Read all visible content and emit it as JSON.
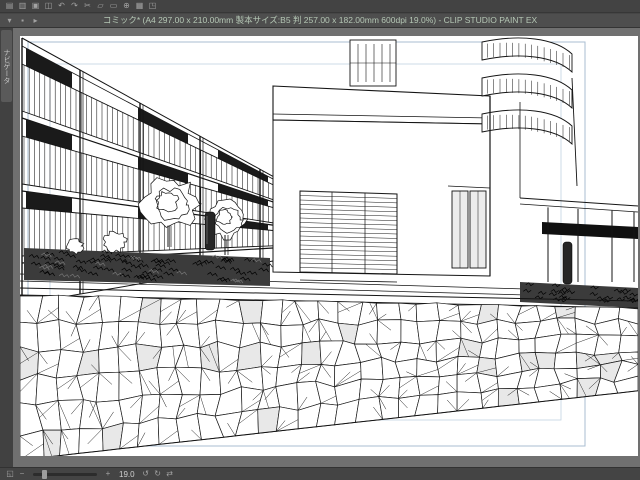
{
  "window": {
    "title": "コミック* (A4 297.00 x 210.00mm 製本サイズ:B5 判 257.00 x 182.00mm 600dpi 19.0%) - CLIP STUDIO PAINT EX"
  },
  "command_bar": {
    "row1_icons": [
      {
        "name": "new-file-icon",
        "glyph": "▤"
      },
      {
        "name": "open-file-icon",
        "glyph": "▥"
      },
      {
        "name": "save-icon",
        "glyph": "▣"
      },
      {
        "name": "save-all-icon",
        "glyph": "◫"
      },
      {
        "name": "undo-icon",
        "glyph": "↶"
      },
      {
        "name": "redo-icon",
        "glyph": "↷"
      },
      {
        "name": "cut-icon",
        "glyph": "✂"
      },
      {
        "name": "copy-icon",
        "glyph": "▱"
      },
      {
        "name": "paste-icon",
        "glyph": "▭"
      },
      {
        "name": "zoom-icon",
        "glyph": "⊕"
      },
      {
        "name": "grid-icon",
        "glyph": "▦"
      },
      {
        "name": "rotate-canvas-icon",
        "glyph": "◳"
      }
    ],
    "row2_icons": [
      {
        "name": "dropdown-icon",
        "glyph": "▾"
      },
      {
        "name": "tool-switch-icon",
        "glyph": "▪"
      },
      {
        "name": "expand-icon",
        "glyph": "▸"
      }
    ]
  },
  "sidebar": {
    "tab_label": "ナビゲータ"
  },
  "statusbar": {
    "left_icons": [
      {
        "name": "fit-to-screen-icon",
        "glyph": "◱"
      },
      {
        "name": "zoom-out-icon",
        "glyph": "−"
      }
    ],
    "right_icons": [
      {
        "name": "zoom-in-icon",
        "glyph": "+"
      }
    ],
    "tool_icons": [
      {
        "name": "rotate-left-icon",
        "glyph": "↺"
      },
      {
        "name": "rotate-right-icon",
        "glyph": "↻"
      },
      {
        "name": "flip-horizontal-icon",
        "glyph": "⇄"
      }
    ],
    "zoom_value": "19.0"
  },
  "colors": {
    "chrome": "#464646",
    "canvas_bg": "#707070",
    "title_text": "#b5c7b5",
    "guide": "#a9bdd2"
  }
}
